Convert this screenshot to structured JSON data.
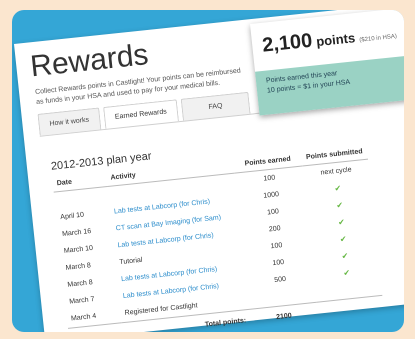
{
  "rewards": {
    "title": "Rewards",
    "subtitle": "Collect Rewards points in Castlight! Your points can be reimbursed as funds in your HSA and used to pay for your medical bills."
  },
  "tabs": [
    {
      "label": "How it works"
    },
    {
      "label": "Earned Rewards"
    },
    {
      "label": "FAQ"
    }
  ],
  "plan_year": "2012-2013 plan year",
  "table": {
    "headers": {
      "date": "Date",
      "activity": "Activity",
      "points": "Points earned",
      "submitted": "Points submitted"
    },
    "rows": [
      {
        "date": "",
        "activity": "",
        "points": "100",
        "submitted": "next cycle"
      },
      {
        "date": "April 10",
        "activity": "Lab tests at Labcorp (for Chris)",
        "points": "1000",
        "submitted": "✔"
      },
      {
        "date": "March 16",
        "activity": "CT scan at Bay Imaging (for Sam)",
        "points": "100",
        "submitted": "✔"
      },
      {
        "date": "March 10",
        "activity": "Lab tests at Labcorp (for Chris)",
        "points": "200",
        "submitted": "✔"
      },
      {
        "date": "March 8",
        "activity": "Tutorial",
        "points": "100",
        "submitted": "✔"
      },
      {
        "date": "March 8",
        "activity": "Lab tests at Labcorp (for Chris)",
        "points": "100",
        "submitted": "✔"
      },
      {
        "date": "March 7",
        "activity": "Lab tests at Labcorp (for Chris)",
        "points": "500",
        "submitted": "✔"
      },
      {
        "date": "March 4",
        "activity": "Registered for Castlight",
        "points": "",
        "submitted": ""
      }
    ],
    "total_label": "Total points:",
    "total_value": "2100"
  },
  "points_box": {
    "points": "2,100",
    "unit": "points",
    "hsa": "($210 in HSA)",
    "earned_label": "Points earned this year",
    "conversion": "10 points = $1 in your HSA"
  },
  "colors": {
    "frame": "#34a6d6",
    "background": "#fbe6cf",
    "accent": "#9ad2c4",
    "link": "#2a8ccb",
    "check": "#67b845"
  }
}
